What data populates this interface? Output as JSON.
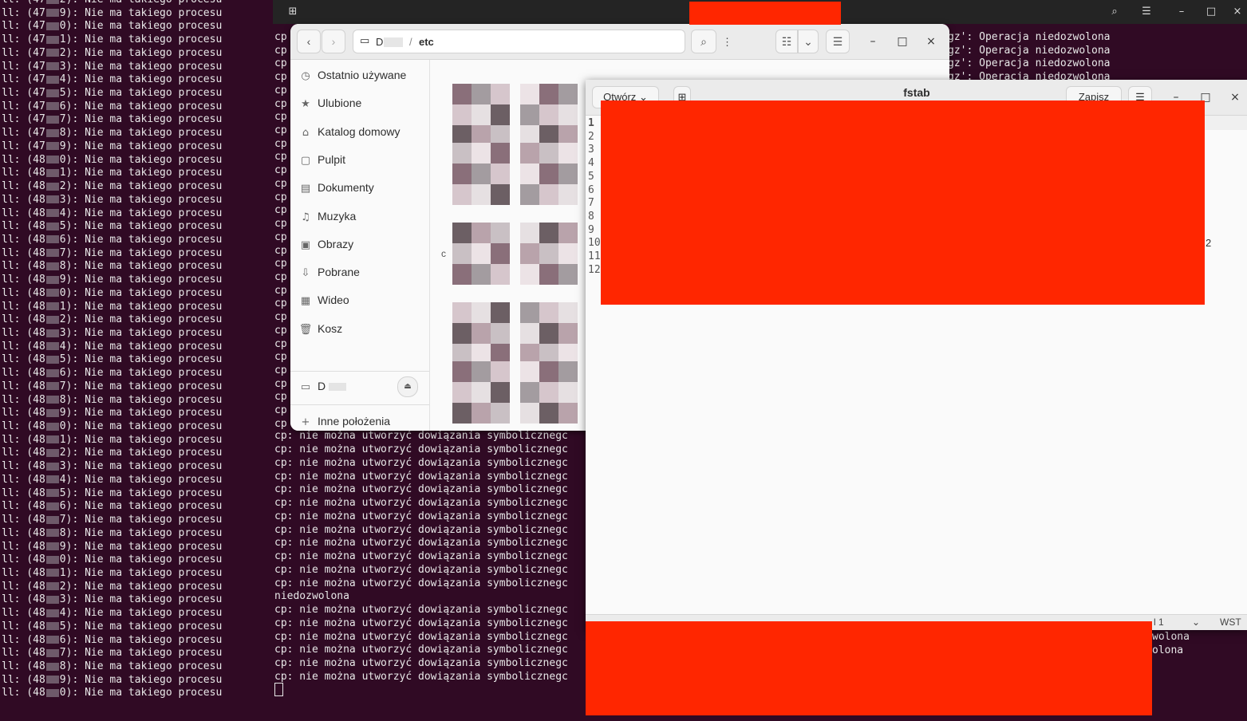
{
  "left_terminal": {
    "prefix": "ll: (",
    "suffix": "): Nie ma takiego procesu",
    "lines": [
      {
        "lead": "47",
        "tail": "2"
      },
      {
        "lead": "47",
        "tail": "9"
      },
      {
        "lead": "47",
        "tail": "0"
      },
      {
        "lead": "47",
        "tail": "1"
      },
      {
        "lead": "47",
        "tail": "2"
      },
      {
        "lead": "47",
        "tail": "3"
      },
      {
        "lead": "47",
        "tail": "4"
      },
      {
        "lead": "47",
        "tail": "5"
      },
      {
        "lead": "47",
        "tail": "6"
      },
      {
        "lead": "47",
        "tail": "7"
      },
      {
        "lead": "47",
        "tail": "8"
      },
      {
        "lead": "47",
        "tail": "9"
      },
      {
        "lead": "48",
        "tail": "0"
      },
      {
        "lead": "48",
        "tail": "1"
      },
      {
        "lead": "48",
        "tail": "2"
      },
      {
        "lead": "48",
        "tail": "3"
      },
      {
        "lead": "48",
        "tail": "4"
      },
      {
        "lead": "48",
        "tail": "5"
      },
      {
        "lead": "48",
        "tail": "6"
      },
      {
        "lead": "48",
        "tail": "7"
      },
      {
        "lead": "48",
        "tail": "8"
      },
      {
        "lead": "48",
        "tail": "9"
      },
      {
        "lead": "48",
        "tail": "0"
      },
      {
        "lead": "48",
        "tail": "1"
      },
      {
        "lead": "48",
        "tail": "2"
      },
      {
        "lead": "48",
        "tail": "3"
      },
      {
        "lead": "48",
        "tail": "4"
      },
      {
        "lead": "48",
        "tail": "5"
      },
      {
        "lead": "48",
        "tail": "6"
      },
      {
        "lead": "48",
        "tail": "7"
      },
      {
        "lead": "48",
        "tail": "8"
      },
      {
        "lead": "48",
        "tail": "9"
      },
      {
        "lead": "48",
        "tail": "0"
      },
      {
        "lead": "48",
        "tail": "1"
      },
      {
        "lead": "48",
        "tail": "2"
      },
      {
        "lead": "48",
        "tail": "3"
      },
      {
        "lead": "48",
        "tail": "4"
      },
      {
        "lead": "48",
        "tail": "5"
      },
      {
        "lead": "48",
        "tail": "6"
      },
      {
        "lead": "48",
        "tail": "7"
      },
      {
        "lead": "48",
        "tail": "8"
      },
      {
        "lead": "48",
        "tail": "9"
      },
      {
        "lead": "48",
        "tail": "0"
      },
      {
        "lead": "48",
        "tail": "1"
      },
      {
        "lead": "48",
        "tail": "2"
      },
      {
        "lead": "48",
        "tail": "3"
      },
      {
        "lead": "48",
        "tail": "4"
      },
      {
        "lead": "48",
        "tail": "5"
      },
      {
        "lead": "48",
        "tail": "6"
      },
      {
        "lead": "48",
        "tail": "7"
      },
      {
        "lead": "48",
        "tail": "8"
      },
      {
        "lead": "48",
        "tail": "9"
      },
      {
        "lead": "48",
        "tail": "0"
      }
    ]
  },
  "right_terminal": {
    "cp_prefix": "cp",
    "operation_lines": [
      "gz': Operacja niedozwolona",
      "gz': Operacja niedozwolona",
      "gz': Operacja niedozwolona",
      "gz': Operacja niedozwolona"
    ],
    "symlink_line": "cp: nie można utworzyć dowiązania symboliczneg",
    "symlink_tail": "c",
    "niedozwolona_line": "niedozwolona",
    "wolona_1": "wolona",
    "wolona_2": "olona",
    "stray_char": "c",
    "stray_num": "2"
  },
  "files_window": {
    "path_device": "D",
    "path_sep": "/",
    "path_current": "etc",
    "sidebar": [
      {
        "icon": "clock-icon",
        "glyph": "◷",
        "label": "Ostatnio używane"
      },
      {
        "icon": "star-icon",
        "glyph": "★",
        "label": "Ulubione"
      },
      {
        "icon": "home-icon",
        "glyph": "⌂",
        "label": "Katalog domowy"
      },
      {
        "icon": "desktop-icon",
        "glyph": "▢",
        "label": "Pulpit"
      },
      {
        "icon": "document-icon",
        "glyph": "▤",
        "label": "Dokumenty"
      },
      {
        "icon": "music-icon",
        "glyph": "♫",
        "label": "Muzyka"
      },
      {
        "icon": "pictures-icon",
        "glyph": "▣",
        "label": "Obrazy"
      },
      {
        "icon": "download-icon",
        "glyph": "⇩",
        "label": "Pobrane"
      },
      {
        "icon": "video-icon",
        "glyph": "▦",
        "label": "Wideo"
      },
      {
        "icon": "trash-icon",
        "glyph": "🗑",
        "label": "Kosz"
      }
    ],
    "device_label": "D",
    "other_locations": "Inne położenia"
  },
  "gedit": {
    "title": "fstab",
    "open_label": "Otwórz",
    "save_label": "Zapisz",
    "line_numbers": [
      "1",
      "2",
      "3",
      "4",
      "5",
      "6",
      "7",
      "8",
      "9",
      "10",
      "11",
      "12"
    ],
    "status_fragment": "l 1",
    "insert_mode": "WST"
  }
}
